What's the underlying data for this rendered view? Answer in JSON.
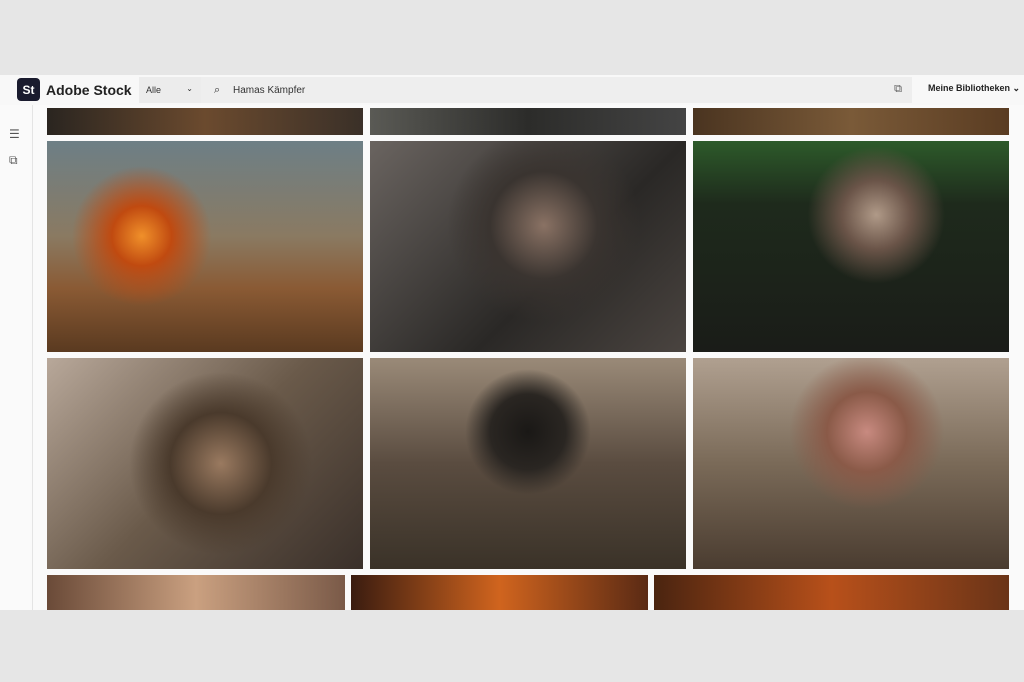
{
  "header": {
    "logo": "St",
    "brand": "Adobe Stock",
    "filter": "Alle",
    "search_value": "Hamas Kämpfer",
    "library": "Meine Bibliotheken"
  },
  "icons": {
    "filter_chevron": "chevron-down-icon",
    "search": "search-icon",
    "visual_search": "visual-search-icon",
    "library_chevron": "chevron-down-icon",
    "sidebar_filters": "sliders-icon",
    "sidebar_visual": "visual-search-icon"
  }
}
